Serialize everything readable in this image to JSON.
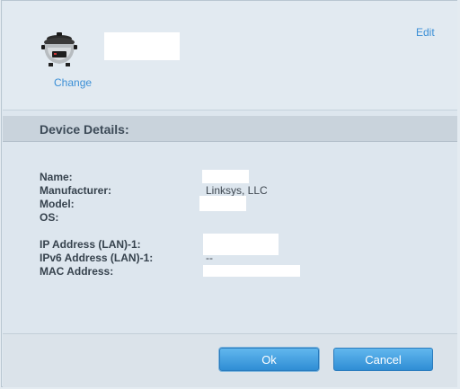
{
  "device": {
    "icon": "slow-cooker-icon",
    "change_label": "Change",
    "edit_label": "Edit"
  },
  "details": {
    "title": "Device Details:",
    "rows": [
      {
        "label": "Name:",
        "value": ""
      },
      {
        "label": "Manufacturer:",
        "value": "Linksys, LLC"
      },
      {
        "label": "Model:",
        "value": ""
      },
      {
        "label": "OS:",
        "value": ""
      },
      {
        "label": "IP Address (LAN)-1:",
        "value": ""
      },
      {
        "label": "IPv6 Address (LAN)-1:",
        "value": "--"
      },
      {
        "label": "MAC Address:",
        "value": ""
      }
    ]
  },
  "buttons": {
    "ok": "Ok",
    "cancel": "Cancel"
  },
  "colors": {
    "link": "#3b8fd6",
    "button": "#3a98dc"
  }
}
